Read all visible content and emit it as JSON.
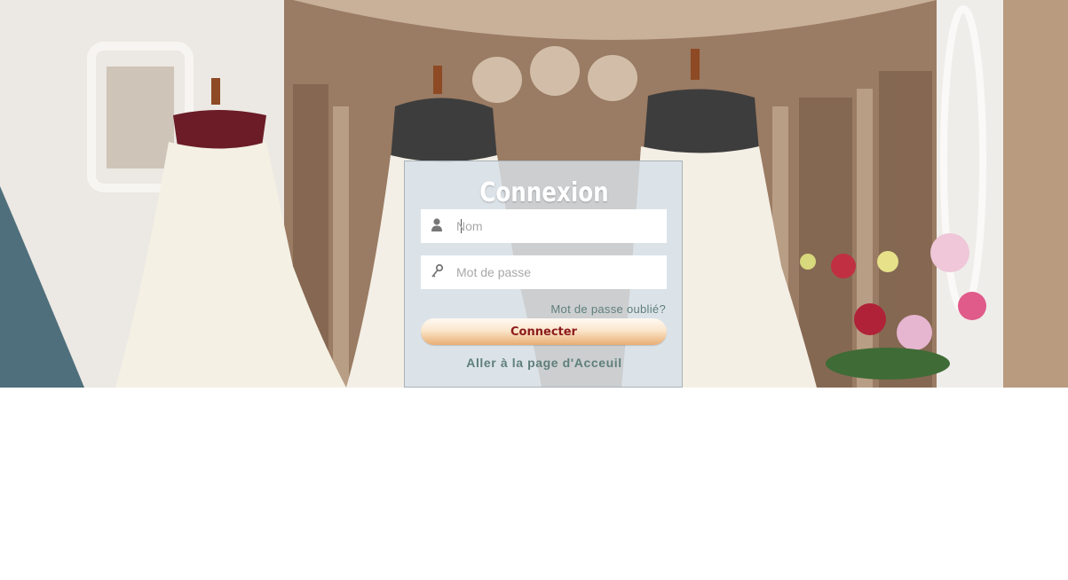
{
  "login": {
    "title": "Connexion",
    "username_placeholder": "Nom",
    "password_placeholder": "Mot de passe",
    "forgot_link": "Mot de passe oublié?",
    "submit_label": "Connecter",
    "home_link": "Aller à la page d'Acceuil"
  },
  "colors": {
    "link": "#5f7f7a",
    "button_text": "#8b1a1a",
    "panel": "#d7e0e8"
  },
  "icons": {
    "username": "user-icon",
    "password": "key-icon"
  }
}
